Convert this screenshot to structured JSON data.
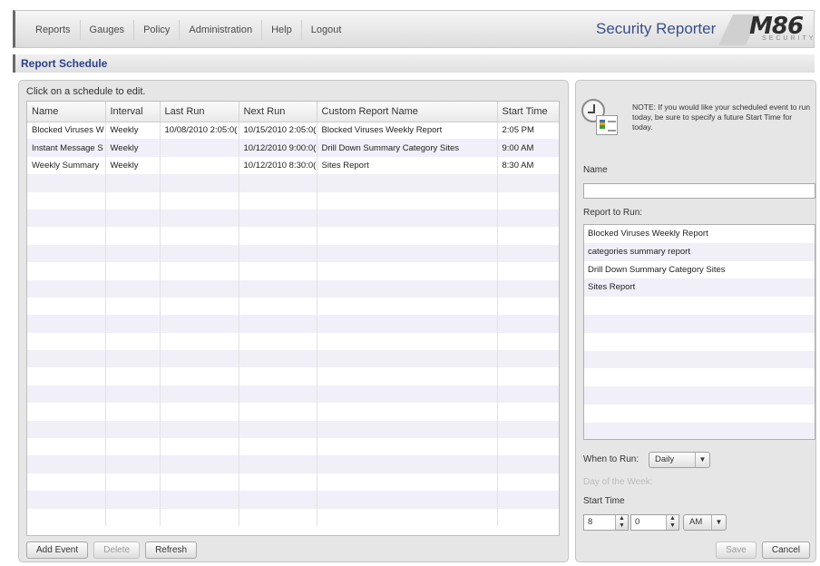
{
  "nav": {
    "items": [
      "Reports",
      "Gauges",
      "Policy",
      "Administration",
      "Help",
      "Logout"
    ],
    "app_title": "Security Reporter",
    "logo_text": "M86",
    "logo_sub": "SECURITY"
  },
  "page": {
    "title": "Report Schedule"
  },
  "schedule": {
    "instruction": "Click on a schedule to edit.",
    "columns": [
      "Name",
      "Interval",
      "Last Run",
      "Next Run",
      "Custom Report Name",
      "Start Time"
    ],
    "rows": [
      [
        "Blocked Viruses W",
        "Weekly",
        "10/08/2010 2:05:0(",
        "10/15/2010 2:05:0(",
        "Blocked Viruses Weekly Report",
        "2:05 PM"
      ],
      [
        "Instant Message S",
        "Weekly",
        "",
        "10/12/2010 9:00:0(",
        "Drill Down Summary Category Sites",
        "9:00 AM"
      ],
      [
        "Weekly Summary",
        "Weekly",
        "",
        "10/12/2010 8:30:0(",
        "Sites Report",
        "8:30 AM"
      ]
    ],
    "buttons": {
      "add": "Add Event",
      "delete": "Delete",
      "refresh": "Refresh"
    }
  },
  "editor": {
    "note": "NOTE: If you would like your scheduled event to run today, be sure to specify a future Start Time for today.",
    "name_label": "Name",
    "name_value": "",
    "report_label": "Report to Run:",
    "reports": [
      "Blocked Viruses Weekly Report",
      "categories summary report",
      "Drill Down Summary Category Sites",
      "Sites Report"
    ],
    "when_label": "When to Run:",
    "when_value": "Daily",
    "dow_label": "Day of the Week:",
    "start_label": "Start Time",
    "hour": "8",
    "minute": "0",
    "ampm": "AM",
    "save": "Save",
    "cancel": "Cancel"
  }
}
